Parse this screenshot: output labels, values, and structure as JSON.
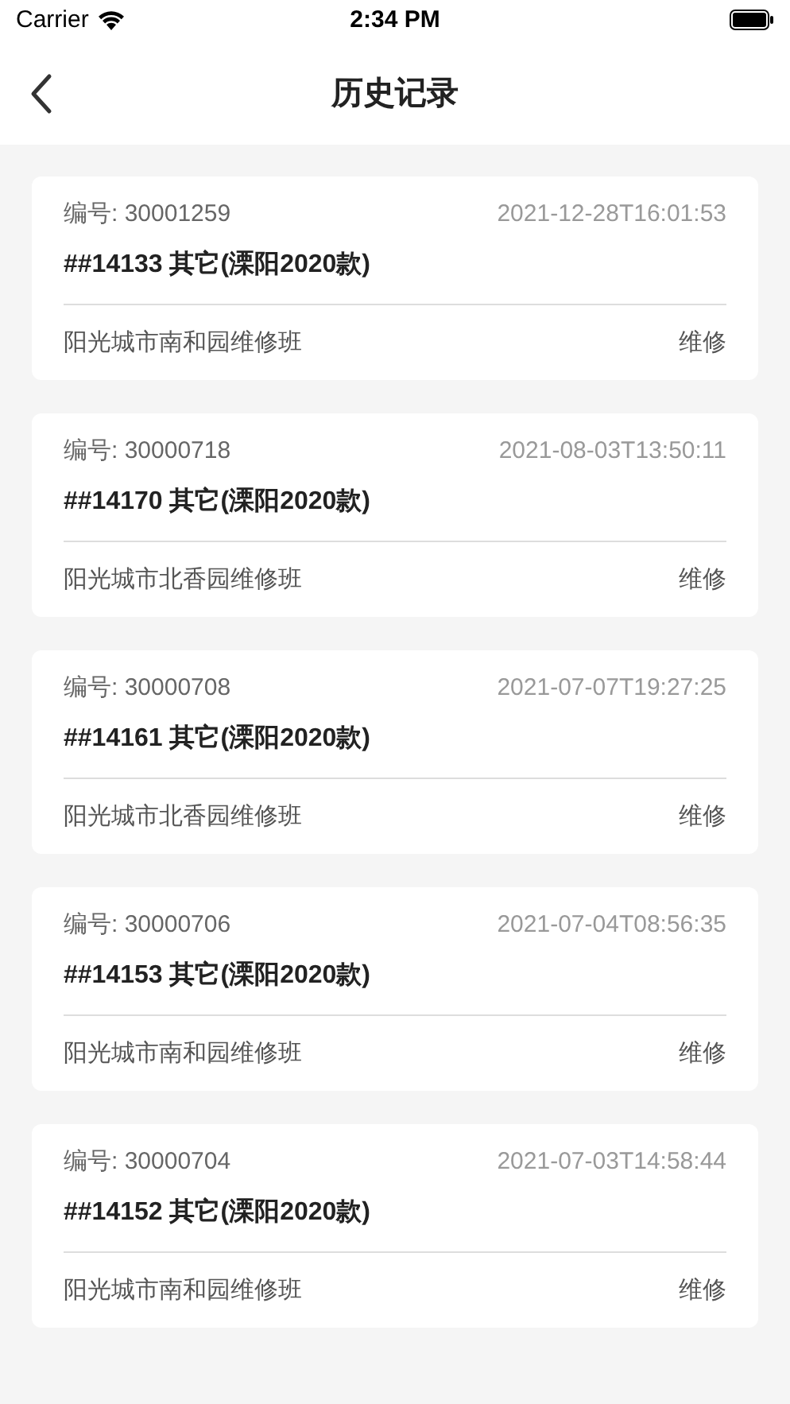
{
  "status_bar": {
    "carrier": "Carrier",
    "time": "2:34 PM"
  },
  "nav": {
    "title": "历史记录"
  },
  "records": [
    {
      "number_label": "编号:",
      "number": "30001259",
      "time": "2021-12-28T16:01:53",
      "title": "##14133 其它(溧阳2020款)",
      "team": "阳光城市南和园维修班",
      "type": "维修"
    },
    {
      "number_label": "编号:",
      "number": "30000718",
      "time": "2021-08-03T13:50:11",
      "title": "##14170 其它(溧阳2020款)",
      "team": "阳光城市北香园维修班",
      "type": "维修"
    },
    {
      "number_label": "编号:",
      "number": "30000708",
      "time": "2021-07-07T19:27:25",
      "title": "##14161 其它(溧阳2020款)",
      "team": "阳光城市北香园维修班",
      "type": "维修"
    },
    {
      "number_label": "编号:",
      "number": "30000706",
      "time": "2021-07-04T08:56:35",
      "title": "##14153 其它(溧阳2020款)",
      "team": "阳光城市南和园维修班",
      "type": "维修"
    },
    {
      "number_label": "编号:",
      "number": "30000704",
      "time": "2021-07-03T14:58:44",
      "title": "##14152 其它(溧阳2020款)",
      "team": "阳光城市南和园维修班",
      "type": "维修"
    }
  ]
}
